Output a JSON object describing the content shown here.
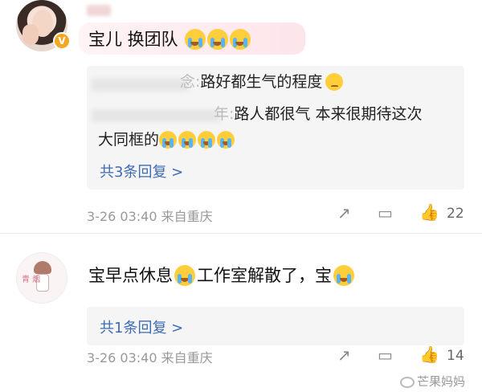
{
  "comments": [
    {
      "text": "宝儿 换团队",
      "emoji_count": 3,
      "replies": [
        {
          "suffix": "念:",
          "text": "路好都生气的程度"
        },
        {
          "suffix": "年:",
          "text": "路人都很气 本来很期待这次",
          "text2": "大同框的"
        }
      ],
      "reply_count_label": "共3条回复 >",
      "meta": "3-26 03:40 来自重庆",
      "likes": "22"
    },
    {
      "text_part1": "宝早点休息",
      "text_part2": "工作室解散了，宝",
      "reply_count_label": "共1条回复 >",
      "meta": "3-26 03:40 来自重庆",
      "likes": "14"
    }
  ],
  "avatar2_tag": "青 烟",
  "watermark": "芒果妈妈",
  "icons": {
    "share": "share-icon",
    "comment": "comment-icon",
    "like": "thumbs-up-icon",
    "verified": "verified-badge-icon"
  },
  "colors": {
    "link": "#3d6bb5",
    "meta": "#999999",
    "verified": "#f5a623"
  }
}
